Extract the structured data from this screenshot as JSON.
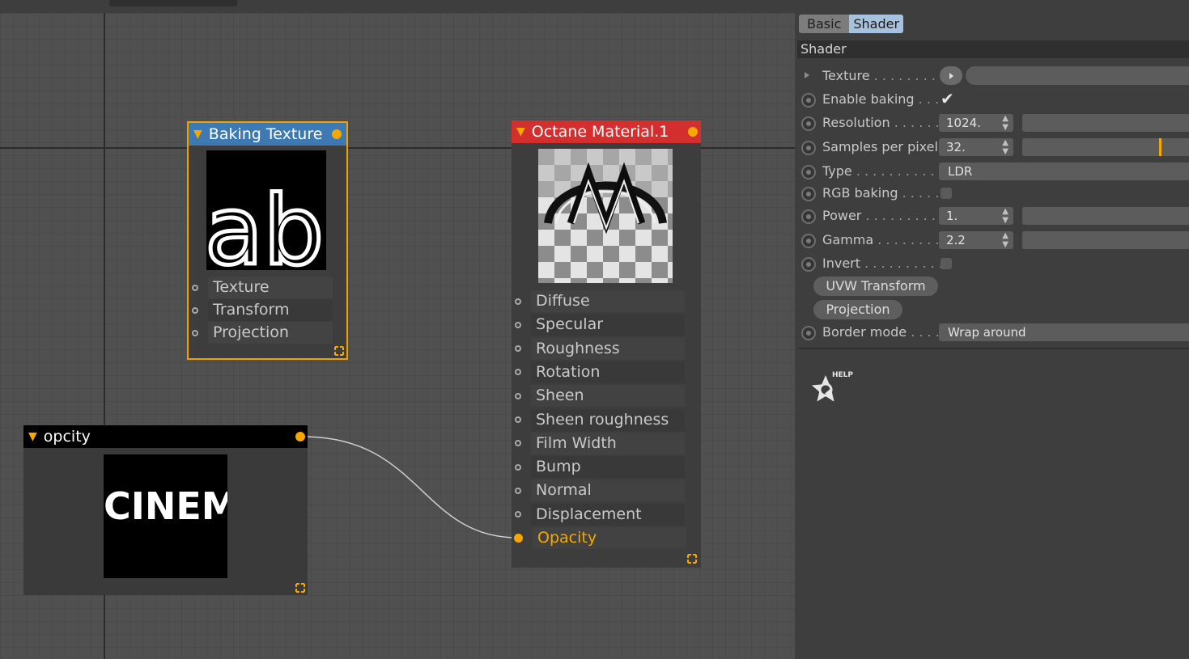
{
  "editor": {
    "nodes": {
      "baking": {
        "title": "Baking Texture",
        "header_color": "#3d7ab4",
        "preview_text": "ab",
        "ports": [
          "Texture",
          "Transform",
          "Projection"
        ]
      },
      "material": {
        "title": "Octane Material.1",
        "header_color": "#d42f2f",
        "ports": [
          "Diffuse",
          "Specular",
          "Roughness",
          "Rotation",
          "Sheen",
          "Sheen roughness",
          "Film Width",
          "Bump",
          "Normal",
          "Displacement",
          "Opacity"
        ],
        "active_port": "Opacity"
      },
      "opcity": {
        "title": "opcity",
        "header_color": "#000000",
        "preview_text": "CINEM"
      }
    },
    "accent_color": "#f7a800"
  },
  "panel": {
    "tabs": [
      "Basic",
      "Shader"
    ],
    "selected_tab": "Shader",
    "section_title": "Shader",
    "rows": {
      "texture": {
        "label": "Texture",
        "dots": " . . . . . . . . ."
      },
      "enable_baking": {
        "label": "Enable baking",
        "dots": " . . .",
        "checked": true
      },
      "resolution": {
        "label": "Resolution",
        "dots": " . . . . . .",
        "value": "1024."
      },
      "samples": {
        "label": "Samples per pixel",
        "dots": "",
        "value": "32.",
        "slider_fraction": 0.82
      },
      "type": {
        "label": "Type",
        "dots": " . . . . . . . . . . .",
        "value": "LDR"
      },
      "rgb_baking": {
        "label": "RGB baking",
        "dots": " . . . . .",
        "checked": false
      },
      "power": {
        "label": "Power",
        "dots": " . . . . . . . . . .",
        "value": "1."
      },
      "gamma": {
        "label": "Gamma",
        "dots": " . . . . . . . .",
        "value": "2.2"
      },
      "invert": {
        "label": "Invert",
        "dots": " . . . . . . . . . .",
        "checked": false
      },
      "border_mode": {
        "label": "Border mode",
        "dots": " . . . .",
        "value": "Wrap around"
      }
    },
    "buttons": {
      "uvw_transform": "UVW Transform",
      "projection": "Projection"
    },
    "help_label": "HELP"
  }
}
